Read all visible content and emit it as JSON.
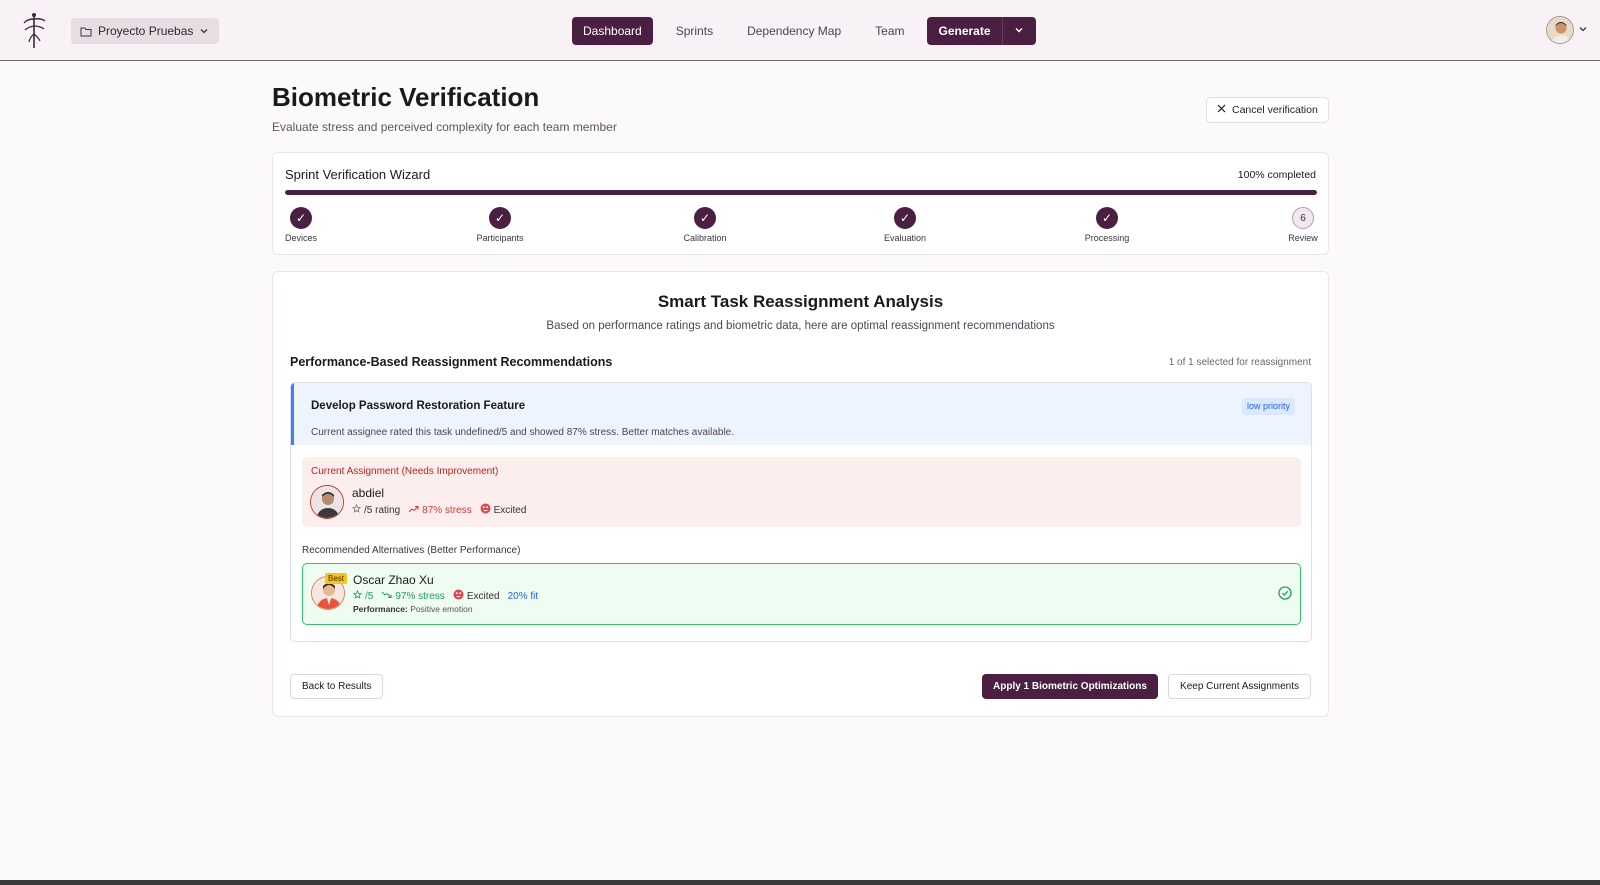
{
  "header": {
    "project_name": "Proyecto Pruebas",
    "nav": [
      "Dashboard",
      "Sprints",
      "Dependency Map",
      "Team"
    ],
    "active_nav": "Dashboard",
    "generate_label": "Generate",
    "icons": {
      "logo": "tree-logo-icon",
      "folder": "folder-icon",
      "caret": "chevron-down-icon",
      "user": "user-avatar"
    }
  },
  "page": {
    "title": "Biometric Verification",
    "subtitle": "Evaluate stress and perceived complexity for each team member",
    "cancel_label": "Cancel verification"
  },
  "wizard": {
    "title": "Sprint Verification Wizard",
    "completed_label": "100% completed",
    "progress": 1.0,
    "steps": [
      {
        "label": "Devices",
        "state": "done",
        "mark": "✓"
      },
      {
        "label": "Participants",
        "state": "done",
        "mark": "✓"
      },
      {
        "label": "Calibration",
        "state": "done",
        "mark": "✓"
      },
      {
        "label": "Evaluation",
        "state": "done",
        "mark": "✓"
      },
      {
        "label": "Processing",
        "state": "done",
        "mark": "✓"
      },
      {
        "label": "Review",
        "state": "current",
        "mark": "6"
      }
    ]
  },
  "analysis": {
    "title": "Smart Task Reassignment Analysis",
    "subtitle": "Based on performance ratings and biometric data, here are optimal reassignment recommendations",
    "section_title": "Performance-Based Reassignment Recommendations",
    "selected_count": "1 of 1 selected for reassignment",
    "task": {
      "name": "Develop Password Restoration Feature",
      "priority": "low priority",
      "description": "Current assignee rated this task undefined/5 and showed 87% stress. Better matches available."
    },
    "current": {
      "label": "Current Assignment (Needs Improvement)",
      "name": "abdiel",
      "rating": "/5 rating",
      "stress": "87% stress",
      "emotion": "Excited"
    },
    "alternatives_label": "Recommended Alternatives (Better Performance)",
    "alternative": {
      "badge": "Best",
      "name": "Oscar Zhao Xu",
      "rating": "/5",
      "stress": "97% stress",
      "emotion": "Excited",
      "fit": "20% fit",
      "performance_label": "Performance:",
      "performance_value": "Positive emotion"
    },
    "buttons": {
      "back": "Back to Results",
      "apply": "Apply 1 Biometric Optimizations",
      "keep": "Keep Current Assignments"
    }
  },
  "colors": {
    "brand": "#4a1f42",
    "priority_blue": "#2563eb",
    "stress_red": "#d03c3c",
    "stress_green": "#22a05a",
    "alt_border": "#34c26a"
  }
}
